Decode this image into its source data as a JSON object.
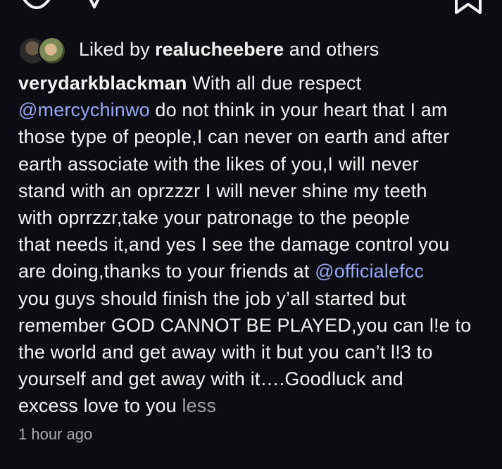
{
  "action_bar": {
    "icons": [
      "heart-icon",
      "share-icon",
      "bookmark-icon"
    ]
  },
  "likes": {
    "prefix": "Liked by",
    "user": "realucheebere",
    "suffix": "and others"
  },
  "caption": {
    "username": "verydarkblackman",
    "line1_text": "With all due respect",
    "mention1": "@mercychinwo",
    "line2_text": "do not think in your heart that I am",
    "line3": "those type of people,I can never on earth and after",
    "line4": "earth associate with the likes of you,I will never",
    "line5": "stand with an oprzzzr I will never shine my teeth",
    "line6": "with oprrzzr,take your patronage to the people",
    "line7": "that needs it,and yes I see the damage control you",
    "line8_text": "are doing,thanks to your friends at",
    "mention2": "@officialefcc",
    "line9": "you guys should finish the job y’all started but",
    "line10": "remember GOD CANNOT BE PLAYED,you can l!e to",
    "line11": "the world and get away with it but you can’t l!3 to",
    "line12": "yourself and get away with it….Goodluck and",
    "line13_text": "excess love to you",
    "less_label": "less"
  },
  "timestamp": "1 hour ago",
  "colors": {
    "background": "#0b0d12",
    "text": "#f5f5f5",
    "mention": "#93a8f7",
    "muted": "#9aa0a6"
  }
}
